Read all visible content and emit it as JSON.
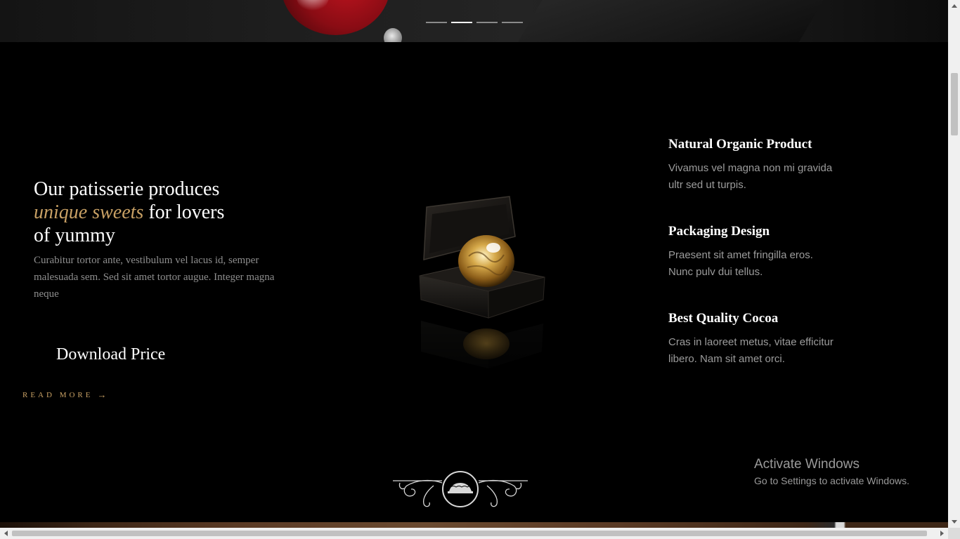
{
  "slider": {
    "active_index": 2,
    "total": 4
  },
  "intro": {
    "heading_line1": "Our patisserie produces",
    "heading_accent": "unique sweets",
    "heading_line2_rest": "for lovers",
    "heading_line3": "of yummy",
    "text": "Curabitur tortor ante, vestibulum vel lacus id, semper malesuada sem. Sed sit amet tortor augue. Integer magna neque",
    "download_label": "Download Price",
    "read_more_label": "READ MORE",
    "read_more_arrow": "→"
  },
  "features": [
    {
      "title": "Natural Organic Product",
      "desc": "Vivamus vel magna non mi gravida ultr sed ut turpis."
    },
    {
      "title": "Packaging Design",
      "desc": "Praesent sit amet fringilla eros. Nunc pulv dui tellus."
    },
    {
      "title": "Best Quality Cocoa",
      "desc": "Cras in laoreet metus, vitae efficitur libero. Nam sit amet orci."
    }
  ],
  "icons": {
    "product": "chocolate-gift-box-icon",
    "ornament": "cake-ornament-icon"
  },
  "colors": {
    "accent": "#c8a064",
    "background": "#000000",
    "muted_text": "#8e8e8e"
  },
  "watermark": {
    "title": "Activate Windows",
    "subtitle": "Go to Settings to activate Windows."
  }
}
